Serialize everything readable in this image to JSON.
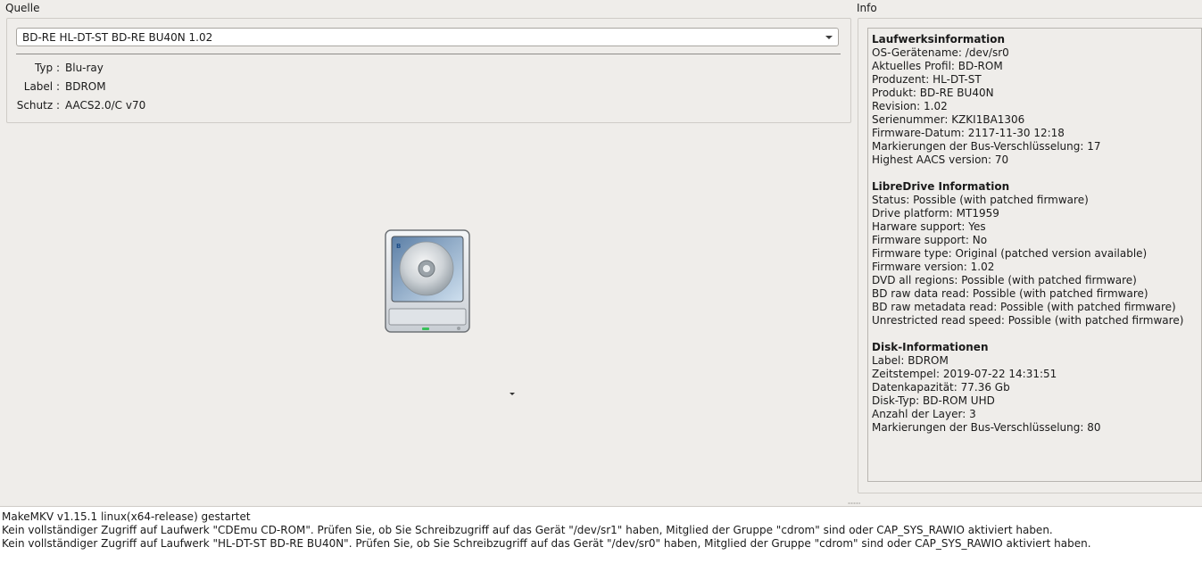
{
  "source": {
    "title": "Quelle",
    "drive_select": "BD-RE HL-DT-ST BD-RE BU40N 1.02",
    "props": [
      {
        "key": "Typ :",
        "value": "Blu-ray"
      },
      {
        "key": "Label :",
        "value": "BDROM"
      },
      {
        "key": "Schutz :",
        "value": "AACS2.0/C v70"
      }
    ],
    "drive_icon": "bluray-drive-icon"
  },
  "info": {
    "title": "Info",
    "sections": [
      {
        "heading": "Laufwerksinformation",
        "lines": [
          "OS-Gerätename: /dev/sr0",
          "Aktuelles Profil: BD-ROM",
          "Produzent: HL-DT-ST",
          "Produkt: BD-RE BU40N",
          "Revision: 1.02",
          "Serienummer: KZKI1BA1306",
          "Firmware-Datum: 2117-11-30 12:18",
          "Markierungen der Bus-Verschlüsselung: 17",
          "Highest AACS version: 70"
        ]
      },
      {
        "heading": "LibreDrive Information",
        "lines": [
          "Status: Possible (with patched firmware)",
          "Drive platform: MT1959",
          "Harware support: Yes",
          "Firmware support: No",
          "Firmware type: Original (patched version available)",
          "Firmware version: 1.02",
          "DVD all regions: Possible (with patched firmware)",
          "BD raw data read: Possible (with patched firmware)",
          "BD raw metadata read: Possible (with patched firmware)",
          "Unrestricted read speed: Possible (with patched firmware)"
        ]
      },
      {
        "heading": "Disk-Informationen",
        "lines": [
          "Label: BDROM",
          "Zeitstempel: 2019-07-22 14:31:51",
          "Datenkapazität: 77.36 Gb",
          "Disk-Typ: BD-ROM UHD",
          "Anzahl der Layer: 3",
          "Markierungen der Bus-Verschlüsselung: 80"
        ]
      }
    ]
  },
  "log": {
    "lines": [
      "MakeMKV v1.15.1 linux(x64-release) gestartet",
      "Kein vollständiger Zugriff auf Laufwerk \"CDEmu CD-ROM\". Prüfen Sie, ob Sie Schreibzugriff auf das Gerät \"/dev/sr1\" haben, Mitglied der Gruppe \"cdrom\" sind oder CAP_SYS_RAWIO aktiviert haben.",
      "Kein vollständiger Zugriff auf Laufwerk \"HL-DT-ST BD-RE BU40N\". Prüfen Sie, ob Sie Schreibzugriff auf das Gerät \"/dev/sr0\" haben, Mitglied der Gruppe \"cdrom\" sind oder CAP_SYS_RAWIO aktiviert haben."
    ]
  }
}
